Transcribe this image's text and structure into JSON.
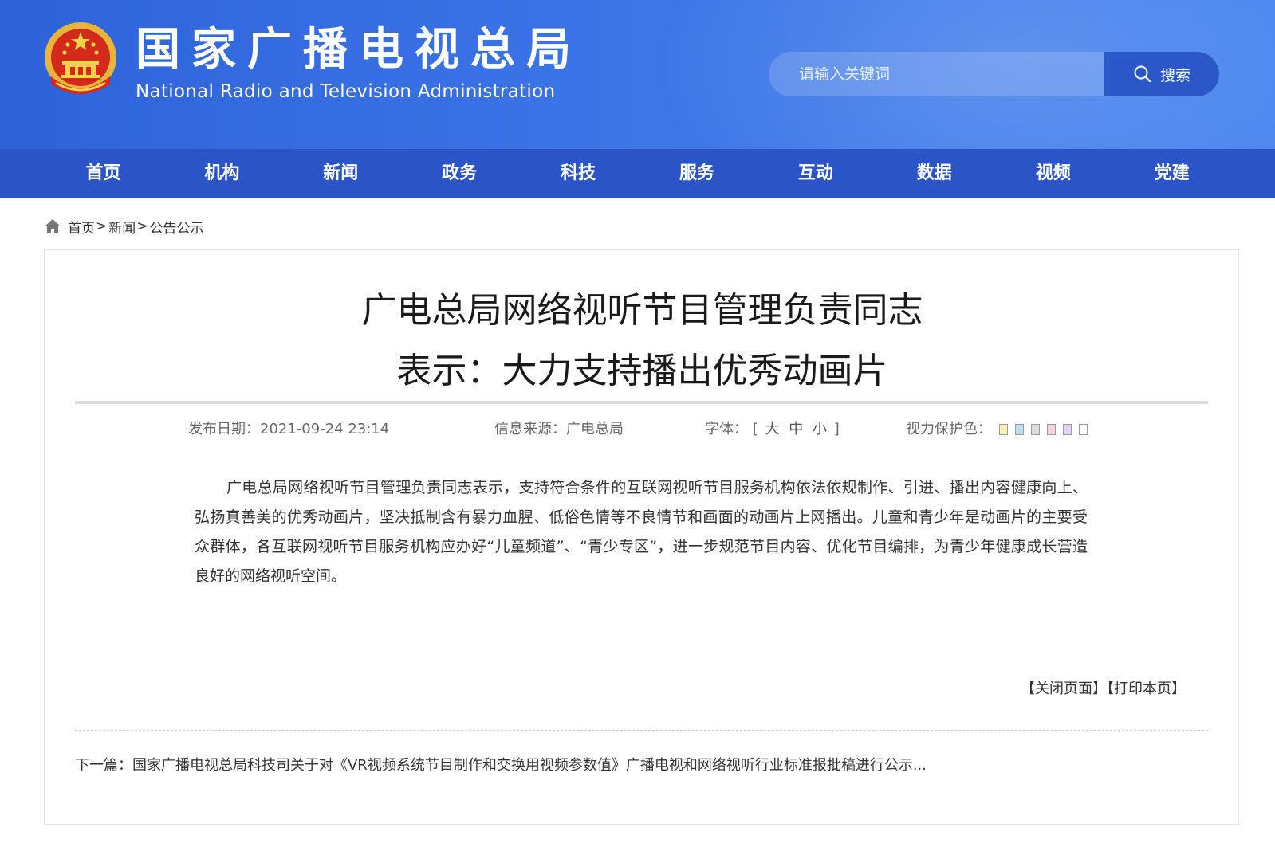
{
  "header": {
    "site_title": "国家广播电视总局",
    "site_subtitle": "National Radio and Television Administration",
    "emblem_icon": "national-emblem-icon",
    "search": {
      "placeholder": "请输入关键词",
      "value": "",
      "button_label": "搜索",
      "button_icon": "search-icon"
    },
    "colors": {
      "header_blue": "#3b74e6",
      "nav_blue": "#2b55c7",
      "search_button": "#2b58c9"
    }
  },
  "nav": {
    "items": [
      {
        "label": "首页"
      },
      {
        "label": "机构"
      },
      {
        "label": "新闻"
      },
      {
        "label": "政务"
      },
      {
        "label": "科技"
      },
      {
        "label": "服务"
      },
      {
        "label": "互动"
      },
      {
        "label": "数据"
      },
      {
        "label": "视频"
      },
      {
        "label": "党建"
      }
    ]
  },
  "breadcrumb": {
    "icon": "home-icon",
    "items": [
      {
        "label": "首页"
      },
      {
        "label": "新闻"
      },
      {
        "label": "公告公示"
      }
    ],
    "separator": ">"
  },
  "article": {
    "title_line1": "广电总局网络视听节目管理负责同志",
    "title_line2": "表示：大力支持播出优秀动画片",
    "meta": {
      "date_label": "发布日期：",
      "date_value": "2021-09-24 23:14",
      "source_label": "信息来源：",
      "source_value": "广电总局",
      "font_label": "字体：",
      "font_open": "[",
      "font_large": "大",
      "font_medium": "中",
      "font_small": "小",
      "font_close": "]",
      "eye_label": "视力保护色：",
      "eye_colors": [
        "#faf0b4",
        "#bcdcf4",
        "#dcdcdc",
        "#f4d2de",
        "#e2d2f6",
        "#ffffff"
      ]
    },
    "body": "广电总局网络视听节目管理负责同志表示，支持符合条件的互联网视听节目服务机构依法依规制作、引进、播出内容健康向上、弘扬真善美的优秀动画片，坚决抵制含有暴力血腥、低俗色情等不良情节和画面的动画片上网播出。儿童和青少年是动画片的主要受众群体，各互联网视听节目服务机构应办好“儿童频道”、“青少专区”，进一步规范节目内容、优化节目编排，为青少年健康成长营造良好的网络视听空间。",
    "actions": {
      "close_label": "【关闭页面】",
      "print_label": "【打印本页】"
    },
    "next": {
      "label": "下一篇：",
      "title": "国家广播电视总局科技司关于对《VR视频系统节目制作和交换用视频参数值》广播电视和网络视听行业标准报批稿进行公示..."
    }
  }
}
